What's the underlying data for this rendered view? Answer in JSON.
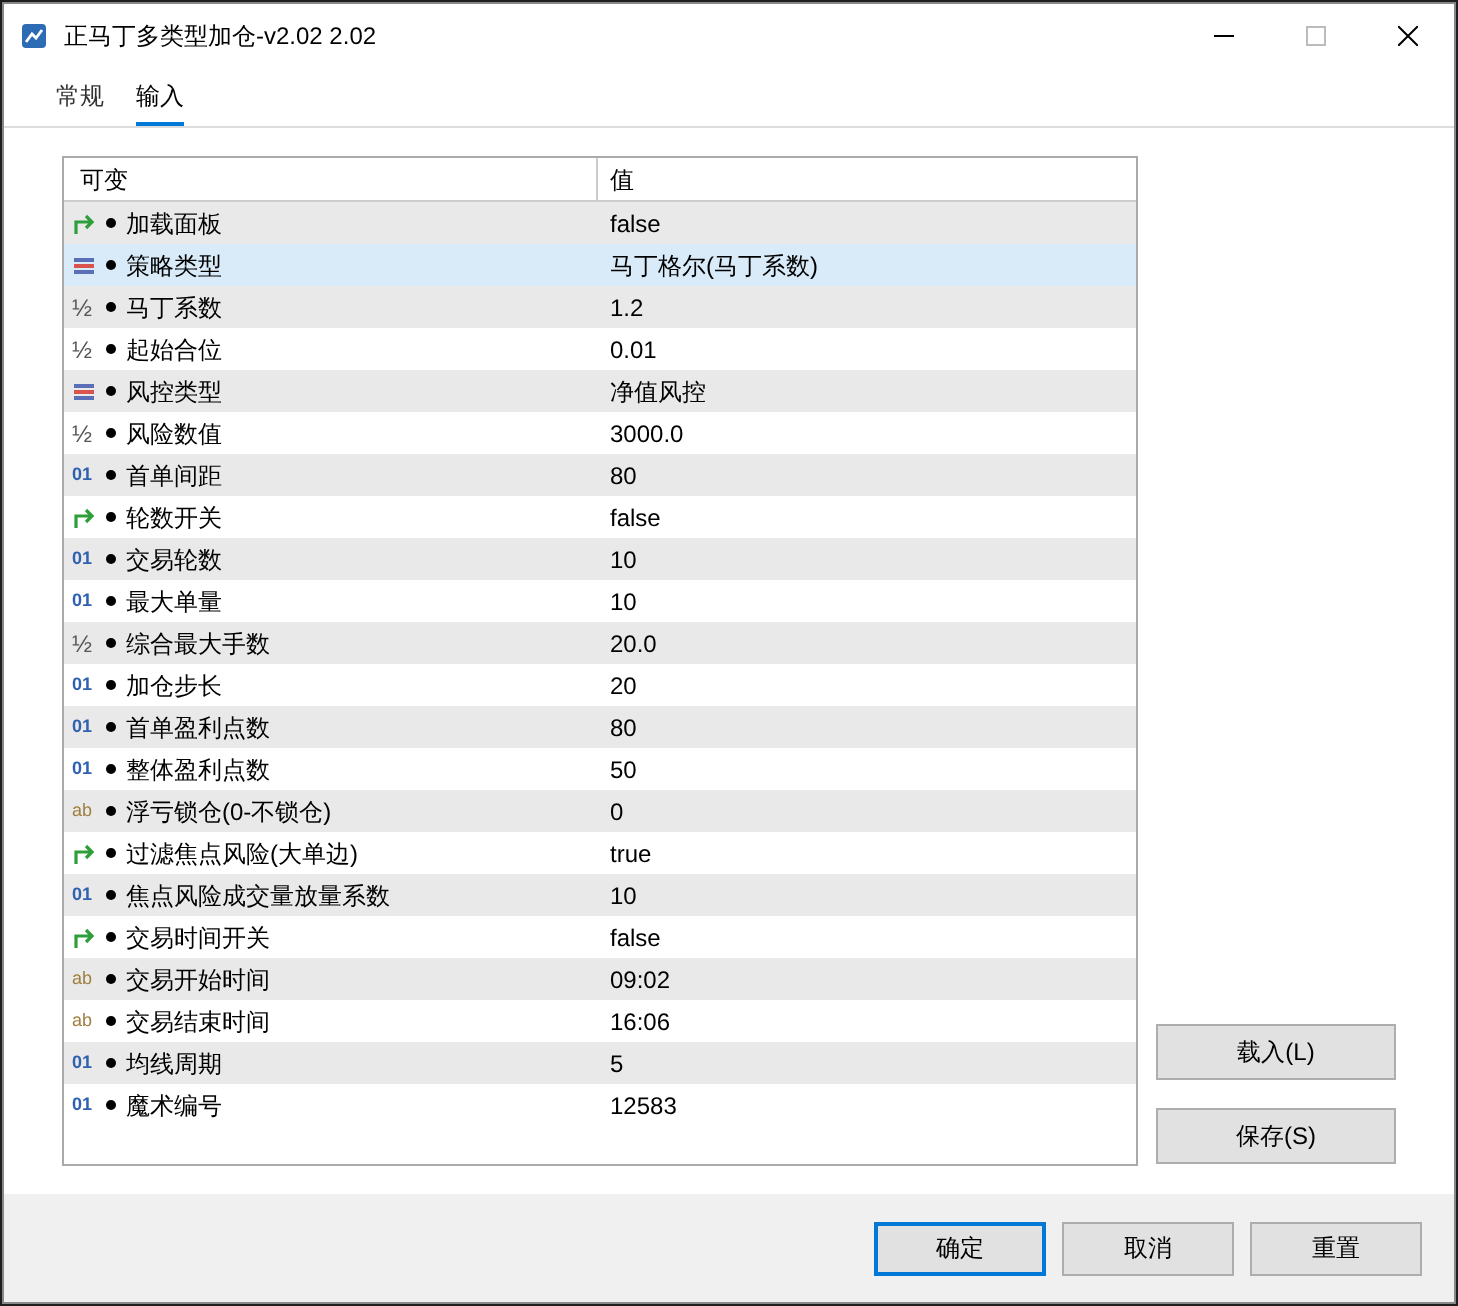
{
  "window": {
    "title": "正马丁多类型加仓-v2.02 2.02"
  },
  "tabs": [
    {
      "label": "常规",
      "selected": false
    },
    {
      "label": "输入",
      "selected": true
    }
  ],
  "table": {
    "columns": [
      "可变",
      "值"
    ],
    "rows": [
      {
        "kind": "bool",
        "name": "加载面板",
        "value": "false",
        "selected": false
      },
      {
        "kind": "enum",
        "name": "策略类型",
        "value": "马丁格尔(马丁系数)",
        "selected": true
      },
      {
        "kind": "double",
        "icon": "½",
        "name": "马丁系数",
        "value": "1.2",
        "selected": false
      },
      {
        "kind": "double",
        "icon": "½",
        "name": "起始合位",
        "value": "0.01",
        "selected": false
      },
      {
        "kind": "enum",
        "name": "风控类型",
        "value": "净值风控",
        "selected": false
      },
      {
        "kind": "double",
        "icon": "½",
        "name": "风险数值",
        "value": "3000.0",
        "selected": false
      },
      {
        "kind": "int",
        "icon": "01",
        "name": "首单间距",
        "value": "80",
        "selected": false
      },
      {
        "kind": "bool",
        "name": "轮数开关",
        "value": "false",
        "selected": false
      },
      {
        "kind": "int",
        "icon": "01",
        "name": "交易轮数",
        "value": "10",
        "selected": false
      },
      {
        "kind": "int",
        "icon": "01",
        "name": "最大单量",
        "value": "10",
        "selected": false
      },
      {
        "kind": "double",
        "icon": "½",
        "name": "综合最大手数",
        "value": "20.0",
        "selected": false
      },
      {
        "kind": "int",
        "icon": "01",
        "name": "加仓步长",
        "value": "20",
        "selected": false
      },
      {
        "kind": "int",
        "icon": "01",
        "name": "首单盈利点数",
        "value": "80",
        "selected": false
      },
      {
        "kind": "int",
        "icon": "01",
        "name": "整体盈利点数",
        "value": "50",
        "selected": false
      },
      {
        "kind": "string",
        "icon": "ab",
        "name": "浮亏锁仓(0-不锁仓)",
        "value": "0",
        "selected": false
      },
      {
        "kind": "bool",
        "name": "过滤焦点风险(大单边)",
        "value": "true",
        "selected": false
      },
      {
        "kind": "int",
        "icon": "01",
        "name": "焦点风险成交量放量系数",
        "value": "10",
        "selected": false
      },
      {
        "kind": "bool",
        "name": "交易时间开关",
        "value": "false",
        "selected": false
      },
      {
        "kind": "string",
        "icon": "ab",
        "name": "交易开始时间",
        "value": "09:02",
        "selected": false
      },
      {
        "kind": "string",
        "icon": "ab",
        "name": "交易结束时间",
        "value": "16:06",
        "selected": false
      },
      {
        "kind": "int",
        "icon": "01",
        "name": "均线周期",
        "value": "5",
        "selected": false
      },
      {
        "kind": "int",
        "icon": "01",
        "name": "魔术编号",
        "value": "12583",
        "selected": false
      }
    ]
  },
  "side_buttons": [
    "载入(L)",
    "保存(S)"
  ],
  "buttons": [
    {
      "label": "确定",
      "default": true
    },
    {
      "label": "取消",
      "default": false
    },
    {
      "label": "重置",
      "default": false
    }
  ]
}
